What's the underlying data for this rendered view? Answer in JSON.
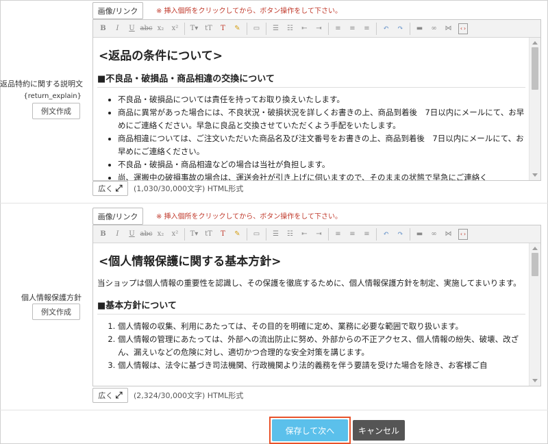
{
  "toolbar": {
    "icons": [
      "bold-icon",
      "italic-icon",
      "underline-icon",
      "strikethrough-icon",
      "subscript-icon",
      "superscript-icon",
      "text-color-icon",
      "text-bgcolor-icon",
      "copy-format-icon",
      "remove-format-icon",
      "table-icon",
      "bulleted-list-icon",
      "numbered-list-icon",
      "outdent-icon",
      "indent-icon",
      "align-left-icon",
      "align-center-icon",
      "align-right-icon",
      "undo-icon",
      "redo-icon",
      "horizontal-rule-icon",
      "link-icon",
      "unlink-icon",
      "source-icon"
    ]
  },
  "fields": [
    {
      "label": "返品特約に関する説明文",
      "variable": "{return_explain}",
      "sample_button": "例文作成",
      "image_link_button": "画像/リンク",
      "image_link_note": "※ 挿入個所をクリックしてから、ボタン操作をして下さい。",
      "editor": {
        "heading": "<返品の条件について>",
        "subheading": "■不良品・破損品・商品相違の交換について",
        "bullets": [
          "不良品・破損品については責任を持ってお取り換えいたします。",
          "商品に異常があった場合には、不良状況・破損状況を詳しくお書きの上、商品到着後　7日以内にメールにて、お早めにご連絡ください。早急に良品と交換させていただくよう手配をいたします。",
          "商品相違については、ご注文いただいた商品名及び注文番号をお書きの上、商品到着後　7日以内にメールにて、お早めにご連絡ください。",
          "不良品・破損品・商品相違などの場合は当社が負担します。",
          "尚、運搬中の破損事故の場合は、運送会社が引き上げに伺いますので、そのままの状態で早急にご連絡く"
        ]
      },
      "widen_button": "広く",
      "char_count": "(1,030/30,000文字) HTML形式"
    },
    {
      "label": "個人情報保護方針",
      "variable": "",
      "sample_button": "例文作成",
      "image_link_button": "画像/リンク",
      "image_link_note": "※ 挿入個所をクリックしてから、ボタン操作をして下さい。",
      "editor": {
        "heading": "<個人情報保護に関する基本方針>",
        "paragraph": "当ショップは個人情報の重要性を認識し、その保護を徹底するために、個人情報保護方針を制定、実施してまいります。",
        "subheading": "■基本方針について",
        "numbered": [
          "個人情報の収集、利用にあたっては、その目的を明確に定め、業務に必要な範囲で取り扱います。",
          "個人情報の管理にあたっては、外部への流出防止に努め、外部からの不正アクセス、個人情報の紛失、破壊、改ざん、漏えいなどの危険に対し、適切かつ合理的な安全対策を講じます。",
          "個人情報は、法令に基づき司法機関、行政機関より法的義務を伴う要請を受けた場合を除き、お客様ご自"
        ]
      },
      "widen_button": "広く",
      "char_count": "(2,324/30,000文字) HTML形式"
    }
  ],
  "actions": {
    "save_label": "保存して次へ",
    "cancel_label": "キャンセル",
    "save_color": "#5bc0eb",
    "save_highlight_color": "#e8522a",
    "cancel_color": "#555555"
  }
}
